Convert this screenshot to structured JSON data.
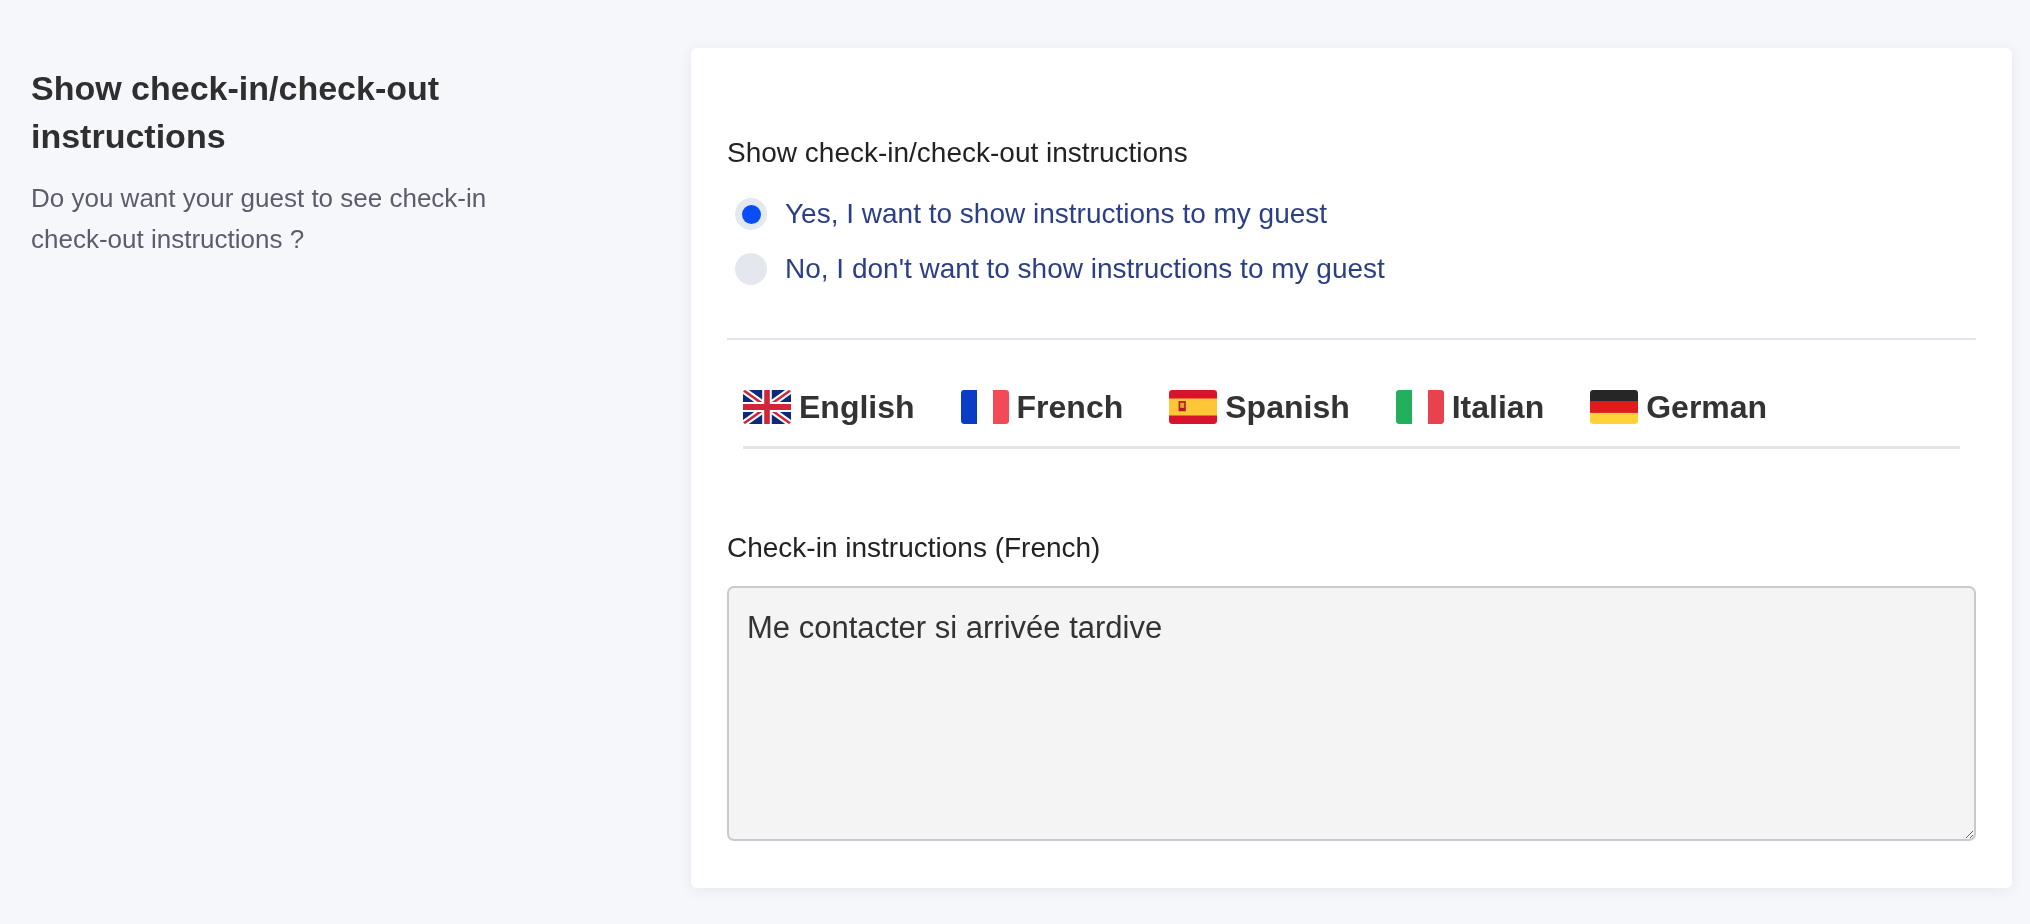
{
  "sidebar": {
    "title": "Show check-in/check-out instructions",
    "description": "Do you want your guest to see check-in check-out instructions ?"
  },
  "form": {
    "question": {
      "label": "Show check-in/check-out instructions",
      "options": [
        {
          "label": "Yes, I want to show instructions to my guest",
          "selected": true
        },
        {
          "label": "No, I don't want to show instructions to my guest",
          "selected": false
        }
      ]
    },
    "language_tabs": [
      {
        "label": "English",
        "kind": "gb"
      },
      {
        "label": "French",
        "kind": "fr"
      },
      {
        "label": "Spanish",
        "kind": "es"
      },
      {
        "label": "Italian",
        "kind": "it"
      },
      {
        "label": "German",
        "kind": "de"
      }
    ],
    "instructions": {
      "label": "Check-in instructions (French)",
      "value": "Me contacter si arrivée tardive"
    }
  }
}
